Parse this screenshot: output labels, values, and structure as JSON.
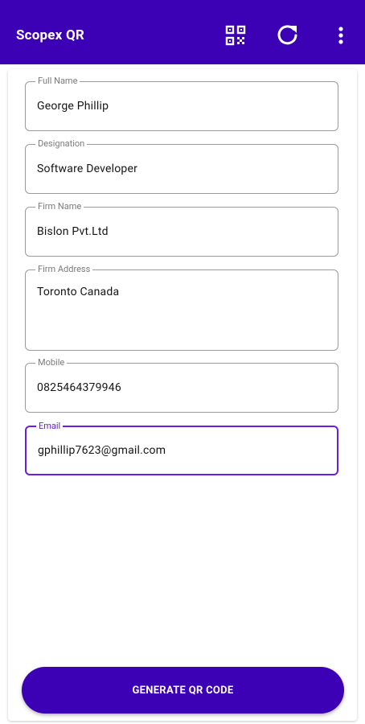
{
  "appbar": {
    "title": "Scopex QR",
    "actions": [
      {
        "icon": "qr-scan-icon"
      },
      {
        "icon": "refresh-icon"
      },
      {
        "icon": "more-vert-icon"
      }
    ]
  },
  "form": {
    "fields": [
      {
        "label": "Full Name",
        "value": "George Phillip"
      },
      {
        "label": "Designation",
        "value": "Software Developer"
      },
      {
        "label": "Firm Name",
        "value": "Bislon Pvt.Ltd"
      },
      {
        "label": "Firm Address",
        "value": "Toronto Canada"
      },
      {
        "label": "Mobile",
        "value": "0825464379946"
      },
      {
        "label": "Email",
        "value": "gphillip7623@gmail.com",
        "focused": true
      }
    ]
  },
  "generate_button": {
    "label": "GENERATE QR CODE"
  },
  "colors": {
    "primary": "#3c00b5",
    "focus_border": "#6a1fe0",
    "field_border": "#9a9a9a"
  }
}
